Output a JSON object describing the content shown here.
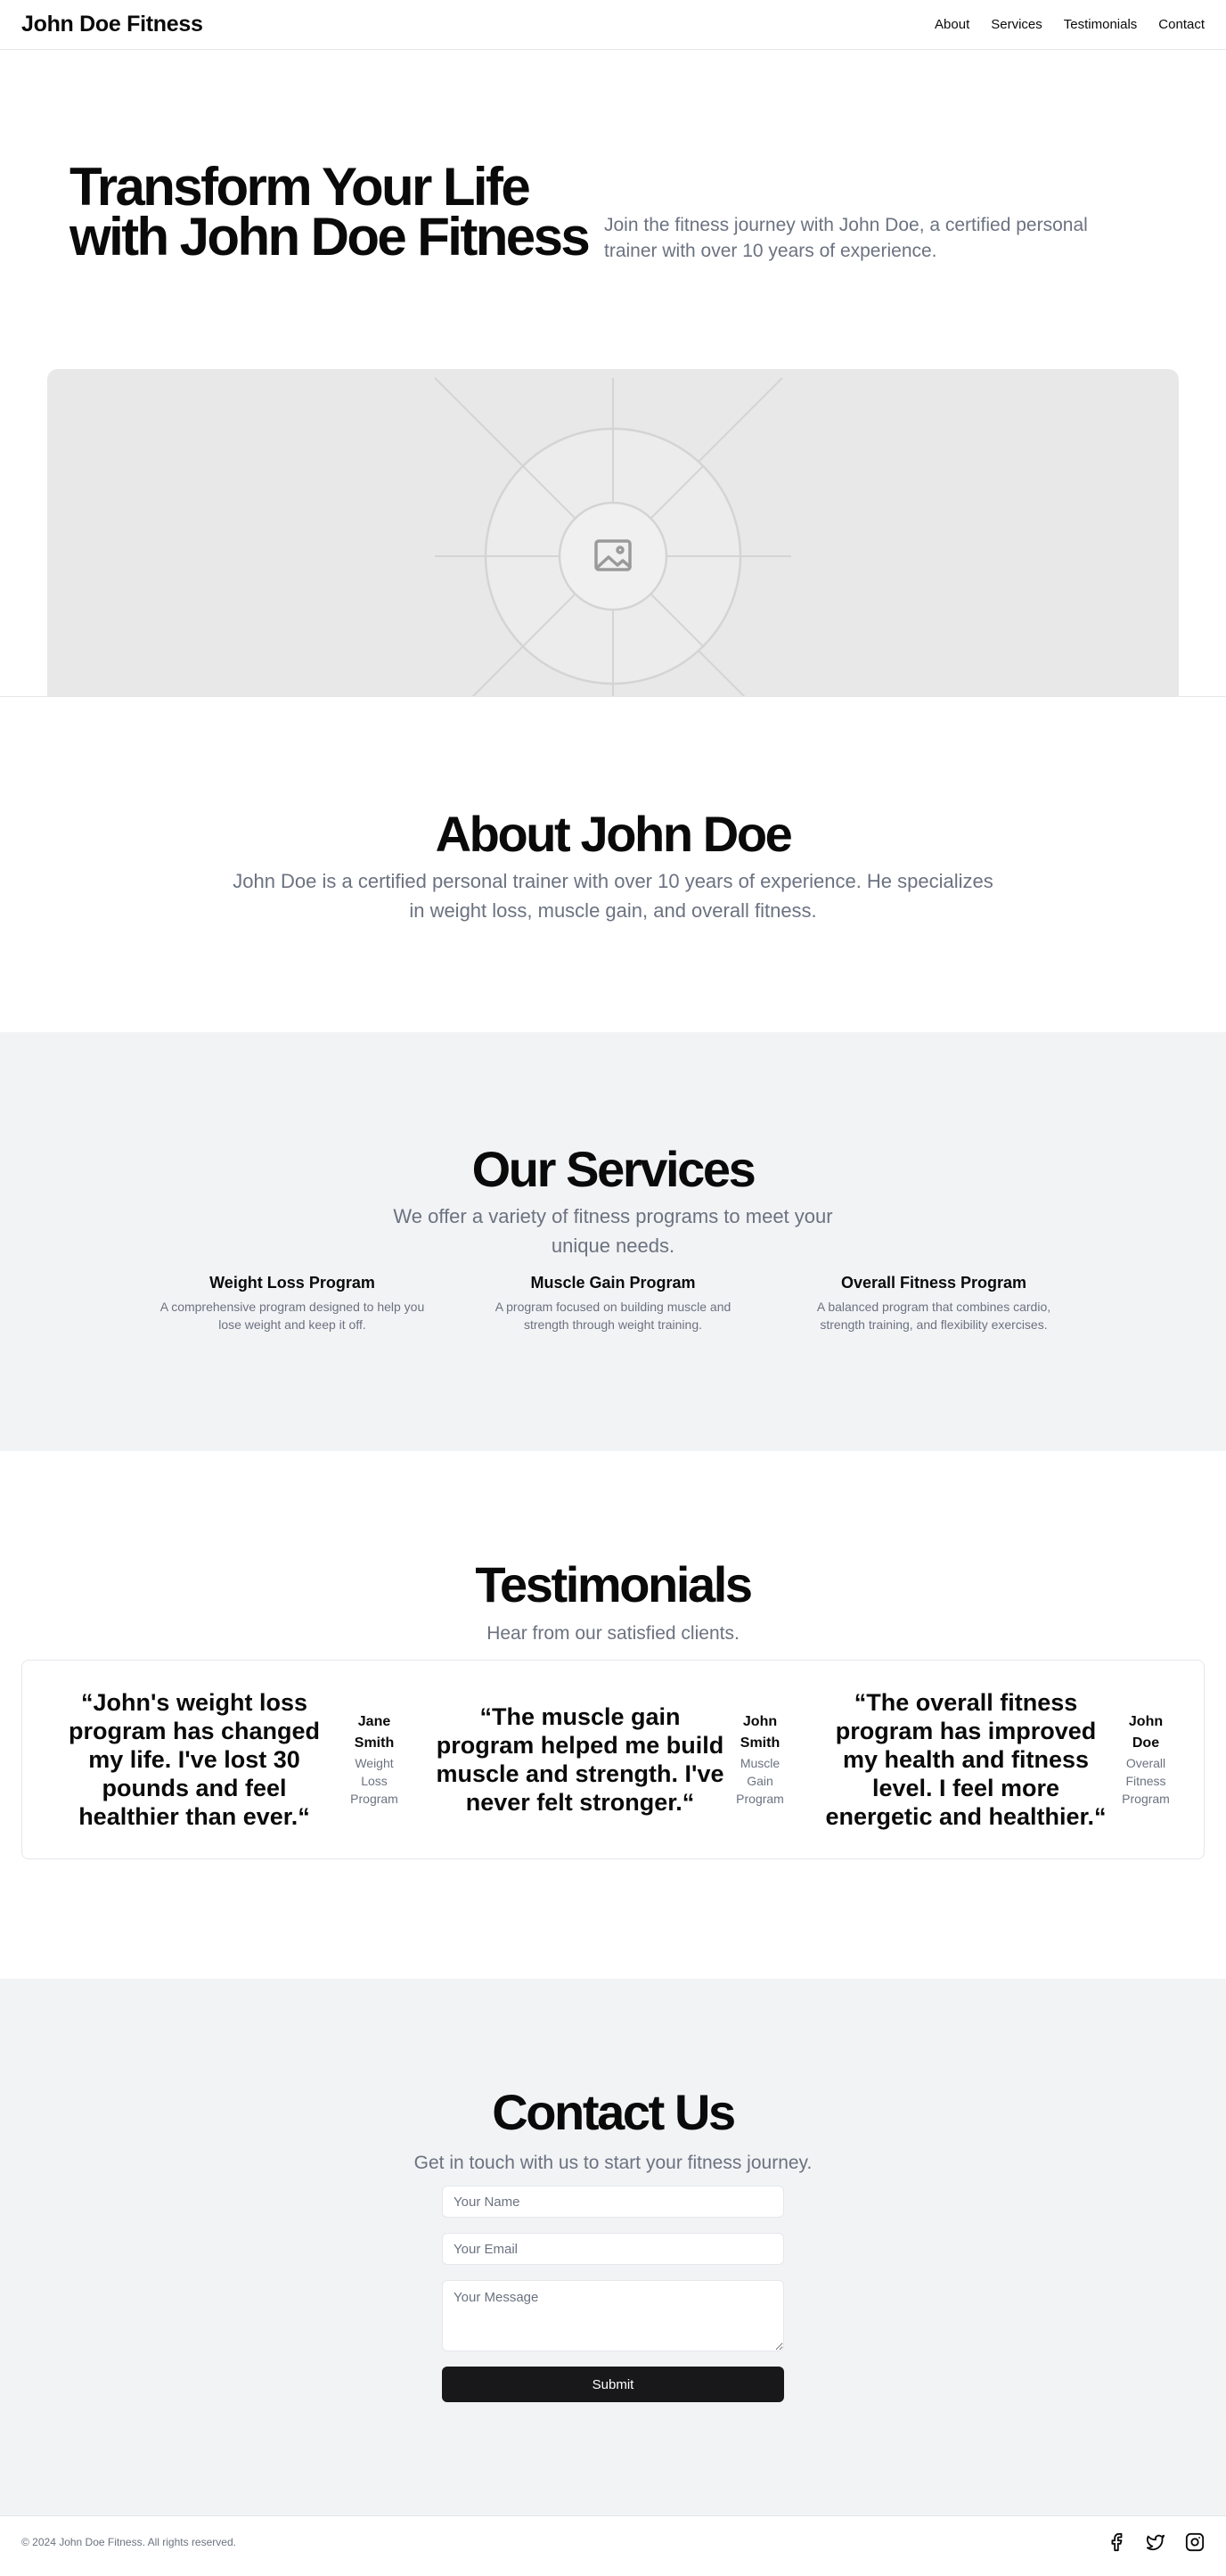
{
  "header": {
    "brand": "John Doe Fitness",
    "nav": [
      "About",
      "Services",
      "Testimonials",
      "Contact"
    ]
  },
  "hero": {
    "title_line1": "Transform Your Life",
    "title_line2": "with John Doe Fitness",
    "subtitle_line1": "Join the fitness journey with John Doe, a certified personal",
    "subtitle_line2": "trainer with over 10 years of experience.",
    "image_icon": "image-placeholder-icon"
  },
  "about": {
    "title": "About John Doe",
    "text": "John Doe is a certified personal trainer with over 10 years of experience. He specializes in weight loss, muscle gain, and overall fitness."
  },
  "services": {
    "title": "Our Services",
    "subtitle": "We offer a variety of fitness programs to meet your unique needs.",
    "items": [
      {
        "title": "Weight Loss Program",
        "desc": "A comprehensive program designed to help you lose weight and keep it off."
      },
      {
        "title": "Muscle Gain Program",
        "desc": "A program focused on building muscle and strength through weight training."
      },
      {
        "title": "Overall Fitness Program",
        "desc": "A balanced program that combines cardio, strength training, and flexibility exercises."
      }
    ]
  },
  "testimonials": {
    "title": "Testimonials",
    "subtitle": "Hear from our satisfied clients.",
    "items": [
      {
        "quote": "“John's weight loss program has changed my life. I've lost 30 pounds and feel healthier than ever.“",
        "name": "Jane Smith",
        "program": "Weight Loss Program"
      },
      {
        "quote": "“The muscle gain program helped me build muscle and strength. I've never felt stronger.“",
        "name": "John Smith",
        "program": "Muscle Gain Program"
      },
      {
        "quote": "“The overall fitness program has improved my health and fitness level. I feel more energetic and healthier.“",
        "name": "John Doe",
        "program": "Overall Fitness Program"
      }
    ]
  },
  "contact": {
    "title": "Contact Us",
    "subtitle": "Get in touch with us to start your fitness journey.",
    "name_placeholder": "Your Name",
    "email_placeholder": "Your Email",
    "message_placeholder": "Your Message",
    "submit_label": "Submit"
  },
  "footer": {
    "copyright": "© 2024 John Doe Fitness. All rights reserved.",
    "socials": [
      "facebook-icon",
      "twitter-icon",
      "instagram-icon"
    ]
  },
  "colors": {
    "text": "#0a0a0a",
    "muted": "#6b7280",
    "section_bg": "#f2f3f5",
    "button_bg": "#18181b",
    "image_bg": "#e8e8e8"
  }
}
